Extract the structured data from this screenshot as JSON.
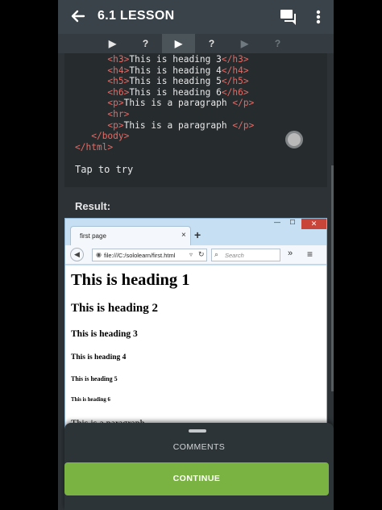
{
  "appbar": {
    "title": "6.1 LESSON",
    "back_icon": "arrow-left-icon",
    "chat_icon": "comments-icon",
    "menu_icon": "more-vertical-icon"
  },
  "steps": [
    {
      "glyph": "▶",
      "state": "done"
    },
    {
      "glyph": "?",
      "state": "done"
    },
    {
      "glyph": "▶",
      "state": "active"
    },
    {
      "glyph": "?",
      "state": "done"
    },
    {
      "glyph": "▶",
      "state": "locked"
    },
    {
      "glyph": "?",
      "state": "locked"
    }
  ],
  "code": {
    "lines": [
      {
        "indent": "      ",
        "open": "<h3>",
        "text": "This is heading 3",
        "close": "</h3>"
      },
      {
        "indent": "      ",
        "open": "<h4>",
        "text": "This is heading 4",
        "close": "</h4>"
      },
      {
        "indent": "      ",
        "open": "<h5>",
        "text": "This is heading 5",
        "close": "</h5>"
      },
      {
        "indent": "      ",
        "open": "<h6>",
        "text": "This is heading 6",
        "close": "</h6>"
      },
      {
        "indent": "      ",
        "open": "<p>",
        "text": "This is a paragraph ",
        "close": "</p>"
      },
      {
        "indent": "      ",
        "open": "<hr>",
        "text": "",
        "close": ""
      },
      {
        "indent": "      ",
        "open": "<p>",
        "text": "This is a paragraph ",
        "close": "</p>"
      },
      {
        "indent": "   ",
        "open": "</body>",
        "text": "",
        "close": ""
      },
      {
        "indent": "",
        "open": "</html>",
        "text": "",
        "close": ""
      }
    ],
    "try_label": "Tap to try"
  },
  "result_label": "Result:",
  "browser": {
    "tab_title": "first page",
    "tab_close": "×",
    "new_tab": "+",
    "window_min": "—",
    "window_max": "☐",
    "window_close": "✕",
    "address": "file:///C:/sololearn/first.html",
    "search_placeholder": "Search",
    "more": "»",
    "menu": "≡",
    "headings": {
      "h1": "This is heading 1",
      "h2": "This is heading 2",
      "h3": "This is heading 3",
      "h4": "This is heading 4",
      "h5": "This is heading 5",
      "h6": "This is heading 6",
      "p": "This is a paragraph"
    }
  },
  "sheet": {
    "comments_label": "COMMENTS",
    "continue_label": "CONTINUE",
    "accent": "#7bb343"
  }
}
